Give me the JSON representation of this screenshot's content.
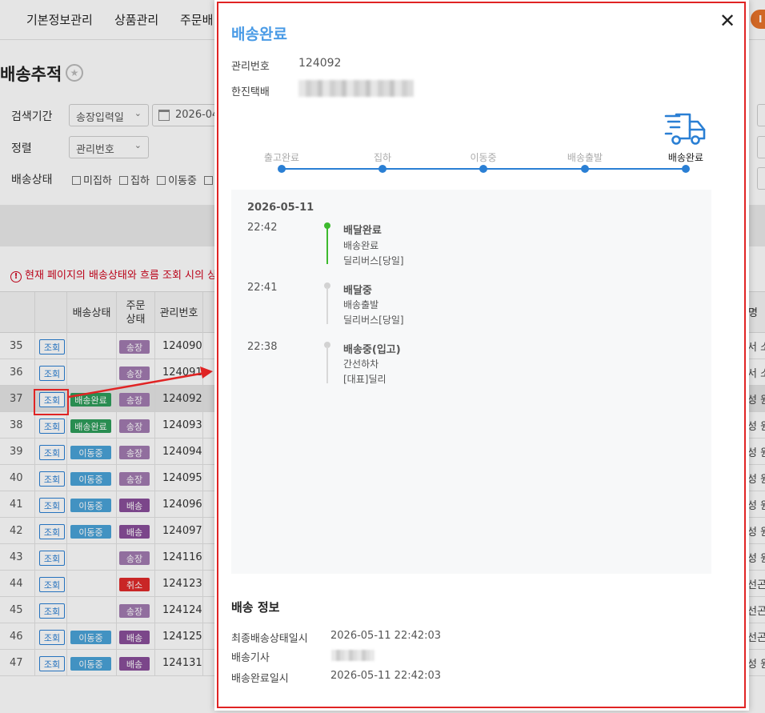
{
  "nav": {
    "items": [
      "기본정보관리",
      "상품관리",
      "주문배"
    ],
    "badge": "I"
  },
  "page": {
    "title": "배송추적"
  },
  "filters": {
    "period_label": "검색기간",
    "period_select": "송장입력일",
    "date_value": "2026-04",
    "sort_label": "정렬",
    "sort_select": "관리번호",
    "status_label": "배송상태",
    "status_options": [
      "미집하",
      "집하",
      "이동중"
    ]
  },
  "warning": "현재 페이지의 배송상태와 흐름 조회 시의 상",
  "table": {
    "headers": [
      "배송상태",
      "주문상태",
      "관리번호",
      "명"
    ],
    "rows": [
      {
        "no": "35",
        "btn": "조회",
        "status": "",
        "order": "송장",
        "mgmt": "124090",
        "right": "서 소"
      },
      {
        "no": "36",
        "btn": "조회",
        "status": "",
        "order": "송장",
        "mgmt": "124091",
        "right": "서 소"
      },
      {
        "no": "37",
        "btn": "조회",
        "status": "배송완료",
        "order": "송장",
        "mgmt": "124092",
        "right": "성 원"
      },
      {
        "no": "38",
        "btn": "조회",
        "status": "배송완료",
        "order": "송장",
        "mgmt": "124093",
        "right": "성 원"
      },
      {
        "no": "39",
        "btn": "조회",
        "status": "이동중",
        "order": "송장",
        "mgmt": "124094",
        "right": "성 원"
      },
      {
        "no": "40",
        "btn": "조회",
        "status": "이동중",
        "order": "송장",
        "mgmt": "124095",
        "right": "성 원"
      },
      {
        "no": "41",
        "btn": "조회",
        "status": "이동중",
        "order": "배송",
        "mgmt": "124096",
        "right": "성 원"
      },
      {
        "no": "42",
        "btn": "조회",
        "status": "이동중",
        "order": "배송",
        "mgmt": "124097",
        "right": "성 원"
      },
      {
        "no": "43",
        "btn": "조회",
        "status": "",
        "order": "송장",
        "mgmt": "124116",
        "right": "성 원"
      },
      {
        "no": "44",
        "btn": "조회",
        "status": "",
        "order": "취소",
        "mgmt": "124123",
        "right": "선곤"
      },
      {
        "no": "45",
        "btn": "조회",
        "status": "",
        "order": "송장",
        "mgmt": "124124",
        "right": "선곤"
      },
      {
        "no": "46",
        "btn": "조회",
        "status": "이동중",
        "order": "배송",
        "mgmt": "124125",
        "right": "선곤"
      },
      {
        "no": "47",
        "btn": "조회",
        "status": "이동중",
        "order": "배송",
        "mgmt": "124131",
        "right": "성 원"
      }
    ]
  },
  "colors": {
    "status_done": "#2e9e5b",
    "status_moving": "#4aa3d8",
    "order_invoice": "#a27bb0",
    "order_ship": "#8a4f9a",
    "order_cancel": "#e02b2b",
    "accent_blue": "#2a7fd4",
    "highlight_red": "#e02424",
    "title_blue": "#4a9be6",
    "timeline_green": "#3dba2e"
  },
  "modal": {
    "title": "배송완료",
    "close_icon": "close-icon",
    "mgmt_label": "관리번호",
    "mgmt_value": "124092",
    "carrier_label": "한진택배",
    "steps": [
      "출고완료",
      "집하",
      "이동중",
      "배송출발",
      "배송완료"
    ],
    "current_step": 5,
    "timeline_date": "2026-05-11",
    "events": [
      {
        "time": "22:42",
        "title": "배달완료",
        "lines": [
          "배송완료",
          "딜리버스[당일]"
        ],
        "active": true
      },
      {
        "time": "22:41",
        "title": "배달중",
        "lines": [
          "배송출발",
          "딜리버스[당일]"
        ],
        "active": false
      },
      {
        "time": "22:38",
        "title": "배송중(입고)",
        "lines": [
          "간선하차",
          "[대표]딜리"
        ],
        "active": false
      }
    ],
    "info_title": "배송 정보",
    "info": [
      {
        "label": "최종배송상태일시",
        "value": "2026-05-11 22:42:03"
      },
      {
        "label": "배송기사",
        "value": ""
      },
      {
        "label": "배송완료일시",
        "value": "2026-05-11 22:42:03"
      }
    ]
  }
}
